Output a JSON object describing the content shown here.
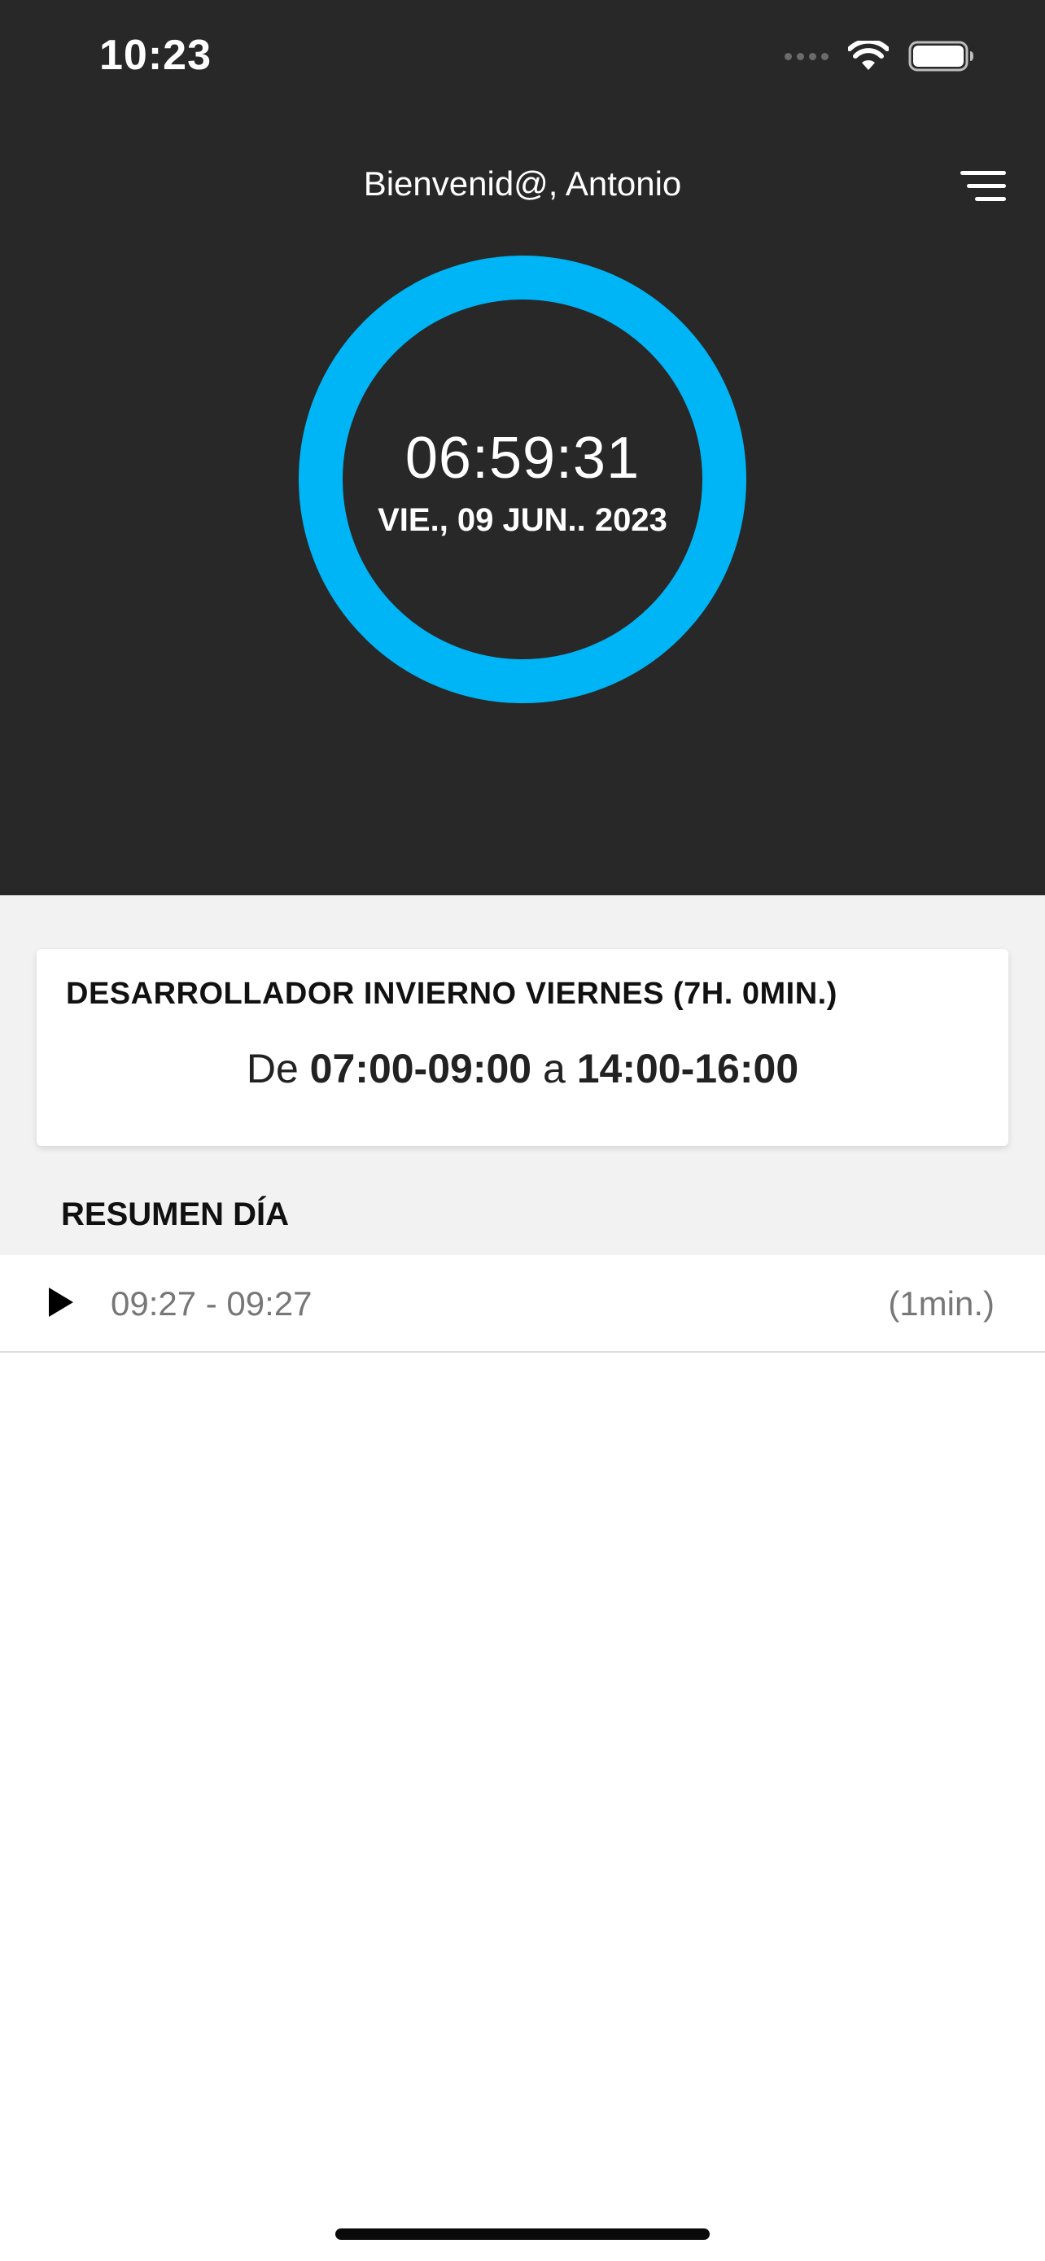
{
  "status_bar": {
    "time": "10:23"
  },
  "header": {
    "welcome": "Bienvenid@, Antonio"
  },
  "clock": {
    "time": "06:59:31",
    "date": "VIE., 09 JUN.. 2023"
  },
  "colors": {
    "header_bg": "#282828",
    "ring": "#00B5F5",
    "gray_bg": "#F2F2F2"
  },
  "schedule_card": {
    "title": "DESARROLLADOR INVIERNO VIERNES (7H. 0MIN.)",
    "from_label": "De",
    "start_range": "07:00-09:00",
    "to_label": "a",
    "end_range": "14:00-16:00"
  },
  "summary": {
    "title": "RESUMEN DÍA",
    "entries": [
      {
        "icon": "play-icon",
        "range": "09:27 - 09:27",
        "duration": "(1min.)"
      }
    ]
  }
}
